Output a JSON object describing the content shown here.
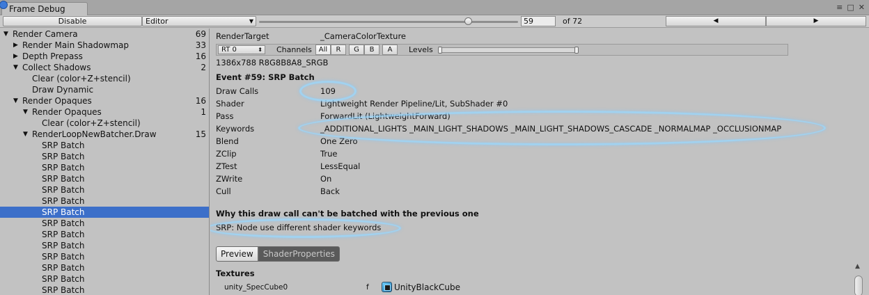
{
  "window": {
    "title": "Frame Debug"
  },
  "toolbar": {
    "disable_label": "Disable",
    "editor_label": "Editor",
    "frame_value": "59",
    "frame_total": "of 72",
    "frame_slider_fraction": 0.81,
    "prev_icon": "◀",
    "next_icon": "▶"
  },
  "tree": [
    {
      "label": "Render Camera",
      "count": "69",
      "depth": 0,
      "arrow": "▼"
    },
    {
      "label": "Render Main Shadowmap",
      "count": "33",
      "depth": 1,
      "arrow": "▶"
    },
    {
      "label": "Depth Prepass",
      "count": "16",
      "depth": 1,
      "arrow": "▶"
    },
    {
      "label": "Collect Shadows",
      "count": "2",
      "depth": 1,
      "arrow": "▼"
    },
    {
      "label": "Clear (color+Z+stencil)",
      "count": "",
      "depth": 2,
      "arrow": ""
    },
    {
      "label": "Draw Dynamic",
      "count": "",
      "depth": 2,
      "arrow": ""
    },
    {
      "label": "Render Opaques",
      "count": "16",
      "depth": 1,
      "arrow": "▼"
    },
    {
      "label": "Render Opaques",
      "count": "1",
      "depth": 2,
      "arrow": "▼"
    },
    {
      "label": "Clear (color+Z+stencil)",
      "count": "",
      "depth": 3,
      "arrow": ""
    },
    {
      "label": "RenderLoopNewBatcher.Draw",
      "count": "15",
      "depth": 2,
      "arrow": "▼"
    },
    {
      "label": "SRP Batch",
      "count": "",
      "depth": 3,
      "arrow": ""
    },
    {
      "label": "SRP Batch",
      "count": "",
      "depth": 3,
      "arrow": ""
    },
    {
      "label": "SRP Batch",
      "count": "",
      "depth": 3,
      "arrow": ""
    },
    {
      "label": "SRP Batch",
      "count": "",
      "depth": 3,
      "arrow": ""
    },
    {
      "label": "SRP Batch",
      "count": "",
      "depth": 3,
      "arrow": ""
    },
    {
      "label": "SRP Batch",
      "count": "",
      "depth": 3,
      "arrow": ""
    },
    {
      "label": "SRP Batch",
      "count": "",
      "depth": 3,
      "arrow": "",
      "selected": true
    },
    {
      "label": "SRP Batch",
      "count": "",
      "depth": 3,
      "arrow": ""
    },
    {
      "label": "SRP Batch",
      "count": "",
      "depth": 3,
      "arrow": ""
    },
    {
      "label": "SRP Batch",
      "count": "",
      "depth": 3,
      "arrow": ""
    },
    {
      "label": "SRP Batch",
      "count": "",
      "depth": 3,
      "arrow": ""
    },
    {
      "label": "SRP Batch",
      "count": "",
      "depth": 3,
      "arrow": ""
    },
    {
      "label": "SRP Batch",
      "count": "",
      "depth": 3,
      "arrow": ""
    },
    {
      "label": "SRP Batch",
      "count": "",
      "depth": 3,
      "arrow": ""
    },
    {
      "label": "SRP Batch",
      "count": "",
      "depth": 3,
      "arrow": ""
    }
  ],
  "detail": {
    "render_target_label": "RenderTarget",
    "render_target_value": "_CameraColorTexture",
    "rt_select": "RT 0",
    "channels_label": "Channels",
    "channels": [
      "All",
      "R",
      "G",
      "B",
      "A"
    ],
    "levels_label": "Levels",
    "resolution": "1386x788 R8G8B8A8_SRGB",
    "event_title": "Event #59: SRP Batch",
    "properties": [
      {
        "key": "Draw Calls",
        "value": "109"
      },
      {
        "key": "Shader",
        "value": "Lightweight Render Pipeline/Lit, SubShader #0"
      },
      {
        "key": "Pass",
        "value": "ForwardLit (LightweightForward)"
      },
      {
        "key": "Keywords",
        "value": "_ADDITIONAL_LIGHTS _MAIN_LIGHT_SHADOWS _MAIN_LIGHT_SHADOWS_CASCADE _NORMALMAP _OCCLUSIONMAP"
      },
      {
        "key": "Blend",
        "value": "One Zero"
      },
      {
        "key": "ZClip",
        "value": "True"
      },
      {
        "key": "ZTest",
        "value": "LessEqual"
      },
      {
        "key": "ZWrite",
        "value": "On"
      },
      {
        "key": "Cull",
        "value": "Back"
      }
    ],
    "batch_heading": "Why this draw call can't be batched with the previous one",
    "batch_reason": "SRP: Node use different shader keywords",
    "preview_label": "Preview",
    "shader_props_label": "ShaderProperties",
    "textures_heading": "Textures",
    "texture_name": "unity_SpecCube0",
    "texture_stage": "f",
    "texture_value": "UnityBlackCube"
  },
  "colors": {
    "selection": "#3c6fc9",
    "highlight_ring": "#96d7ff"
  }
}
